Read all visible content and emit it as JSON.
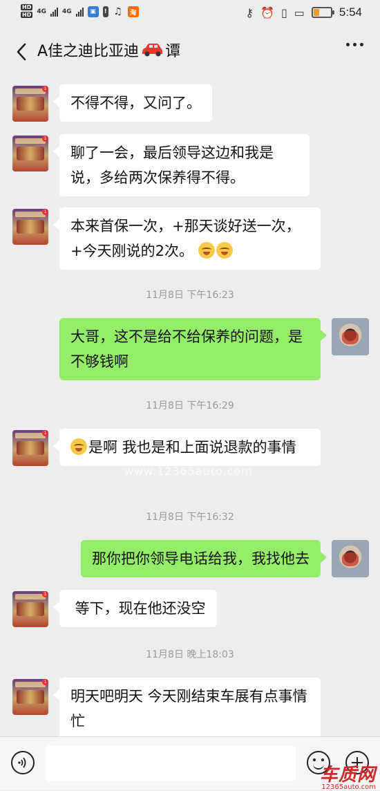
{
  "status_bar": {
    "hd1": "HD",
    "hd2": "HD",
    "net1": "4G",
    "net2": "4G",
    "taobao": "淘",
    "time": "5:54",
    "battery_level": 0.3
  },
  "header": {
    "title_prefix": "A佳之迪比亚迪",
    "title_suffix": "谭"
  },
  "watermark": "www.12365auto.com",
  "messages": [
    {
      "side": "in",
      "text": "不得不得，又问了。"
    },
    {
      "side": "in",
      "text": "聊了一会，最后领导这边和我是说，多给两次保养得不得。"
    },
    {
      "side": "in",
      "text": "本来首保一次，+那天谈好送一次，+今天刚说的2次。"
    },
    {
      "timestamp": "11月8日 下午16:23"
    },
    {
      "side": "out",
      "text": "大哥，这不是给不给保养的问题，是不够钱啊"
    },
    {
      "timestamp": "11月8日 下午16:29"
    },
    {
      "side": "in",
      "text": "是啊 我也是和上面说退款的事情"
    },
    {
      "timestamp": "11月8日 下午16:32"
    },
    {
      "side": "out",
      "text": "那你把你领导电话给我，我找他去"
    },
    {
      "side": "in",
      "text": " 等下，现在他还没空"
    },
    {
      "timestamp": "11月8日 晚上18:03"
    },
    {
      "side": "in",
      "text": "明天吧明天 今天刚结束车展有点事情忙"
    }
  ],
  "input": {
    "value": "",
    "placeholder": ""
  },
  "brand": {
    "name": "车质网",
    "url": "12365auto.com"
  },
  "icons": {
    "back": "chevron-left-icon",
    "more": "more-dots-icon",
    "voice": "voice-icon",
    "emoji": "emoji-icon",
    "plus": "plus-icon"
  }
}
